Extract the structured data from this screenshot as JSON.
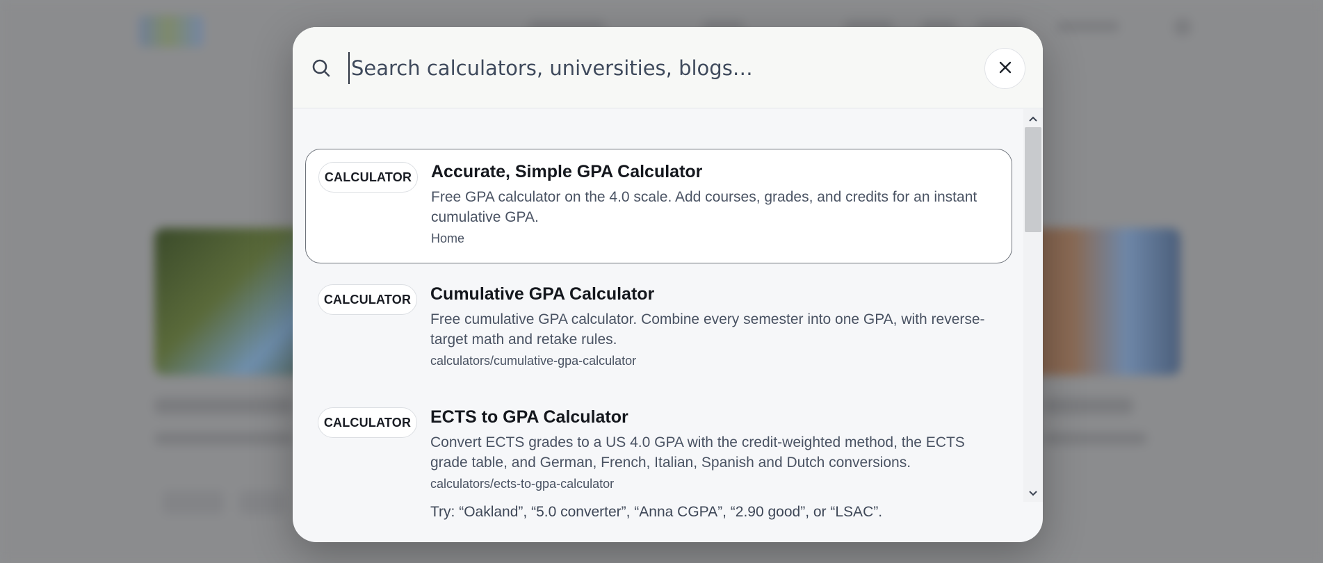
{
  "search": {
    "placeholder": "Search calculators, universities, blogs…",
    "value": ""
  },
  "results": [
    {
      "badge": "CALCULATOR",
      "title": "Accurate, Simple GPA Calculator",
      "description": "Free GPA calculator on the 4.0 scale. Add courses, grades, and credits for an instant cumulative GPA.",
      "path": "Home",
      "active": true
    },
    {
      "badge": "CALCULATOR",
      "title": "Cumulative GPA Calculator",
      "description": "Free cumulative GPA calculator. Combine every semester into one GPA, with reverse-target math and retake rules.",
      "path": "calculators/cumulative-gpa-calculator",
      "active": false
    },
    {
      "badge": "CALCULATOR",
      "title": "ECTS to GPA Calculator",
      "description": "Convert ECTS grades to a US 4.0 GPA with the credit-weighted method, the ECTS grade table, and German, French, Italian, Spanish and Dutch conversions.",
      "path": "calculators/ects-to-gpa-calculator",
      "active": false
    }
  ],
  "hint": "Try: “Oakland”, “5.0 converter”, “Anna CGPA”, “2.90 good”, or “LSAC”.",
  "icons": {
    "search": "search-icon",
    "close": "close-icon",
    "scroll_up": "chevron-up-icon",
    "scroll_down": "chevron-down-icon"
  },
  "colors": {
    "overlay": "#8e8f91",
    "modal_bg": "#f6f7f9",
    "active_border": "#6f747c",
    "title_text": "#14171d",
    "body_text": "#4a5363"
  }
}
